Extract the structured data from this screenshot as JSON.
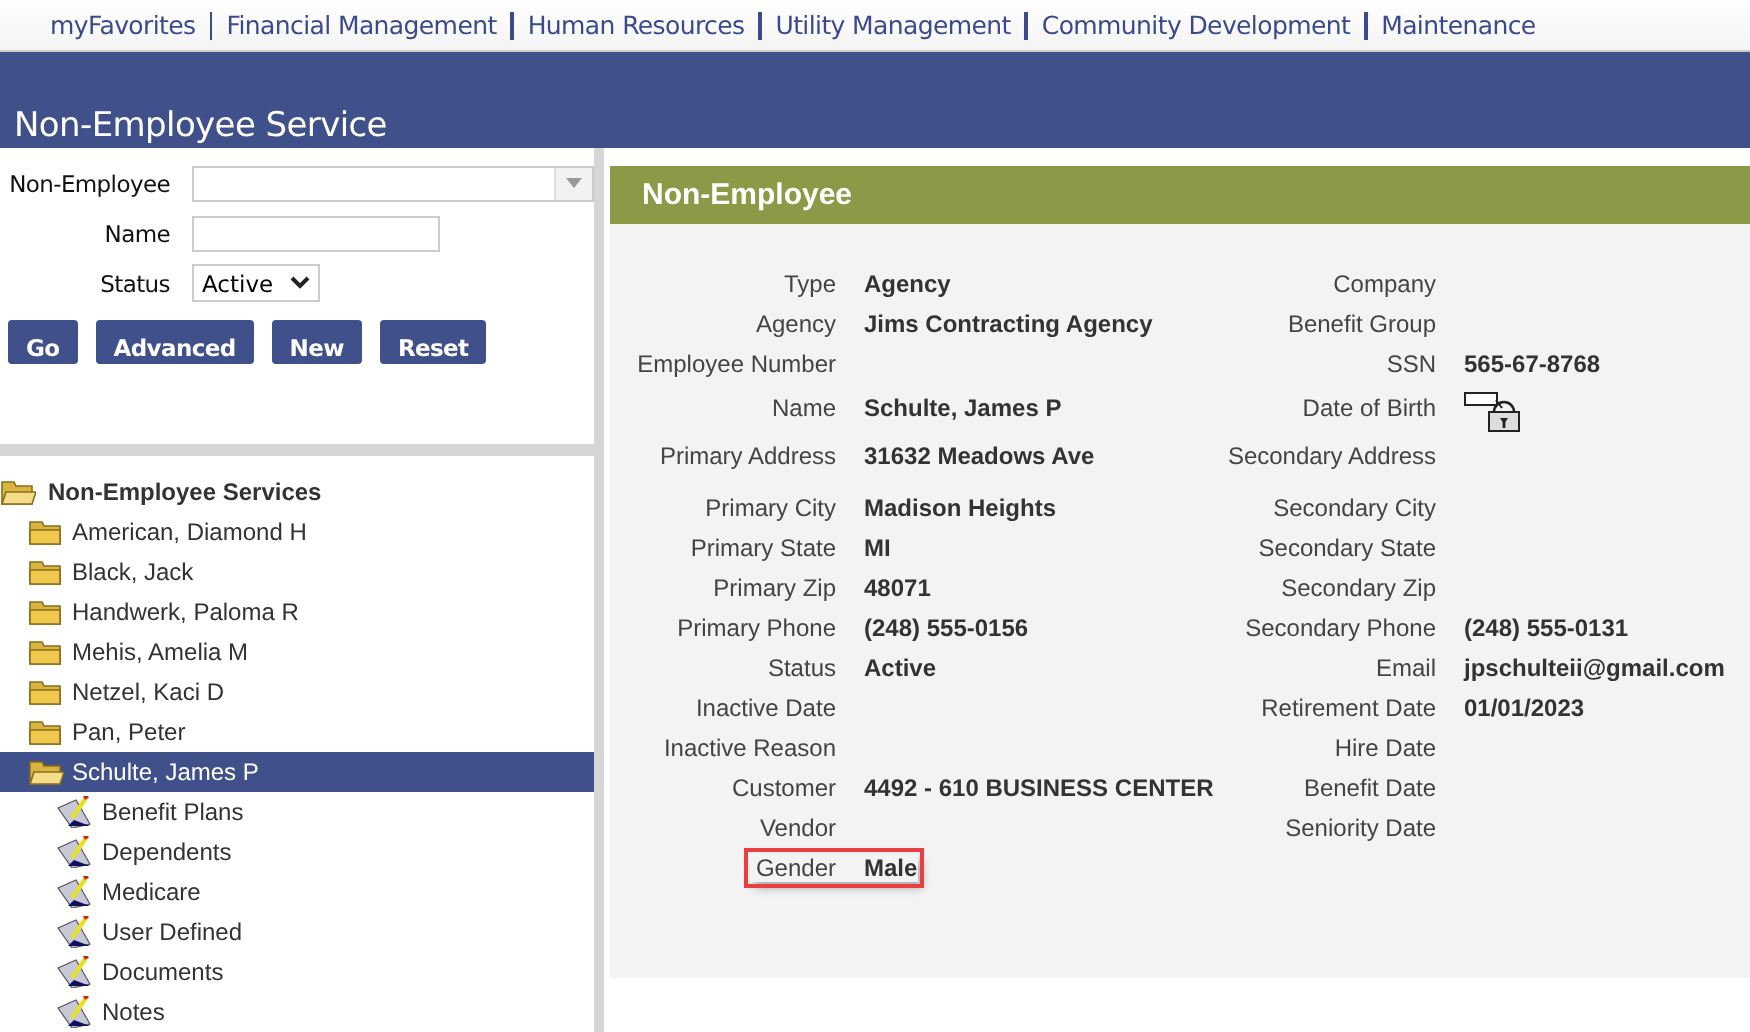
{
  "menu": [
    "myFavorites",
    "Financial Management",
    "Human Resources",
    "Utility Management",
    "Community Development",
    "Maintenance"
  ],
  "page_title": "Non-Employee Service",
  "search": {
    "fields": [
      {
        "kind": "combo",
        "label": "Non-Employee"
      },
      {
        "kind": "text",
        "label": "Name"
      },
      {
        "kind": "select",
        "label": "Status",
        "value": "Active"
      }
    ],
    "buttons": [
      "Go",
      "Advanced",
      "New",
      "Reset"
    ]
  },
  "tree": {
    "label": "Non-Employee Services",
    "expanded": true,
    "children": [
      {
        "label": "American, Diamond H",
        "kind": "folder",
        "expanded": false,
        "selected": false
      },
      {
        "label": "Black, Jack",
        "kind": "folder",
        "expanded": false,
        "selected": false
      },
      {
        "label": "Handwerk, Paloma R",
        "kind": "folder",
        "expanded": false,
        "selected": false
      },
      {
        "label": "Mehis, Amelia M",
        "kind": "folder",
        "expanded": false,
        "selected": false
      },
      {
        "label": "Netzel, Kaci D",
        "kind": "folder",
        "expanded": false,
        "selected": false
      },
      {
        "label": "Pan, Peter",
        "kind": "folder",
        "expanded": false,
        "selected": false
      },
      {
        "label": "Schulte, James P",
        "kind": "folder",
        "expanded": true,
        "selected": true,
        "children": [
          {
            "label": "Benefit Plans",
            "kind": "page",
            "selected": false
          },
          {
            "label": "Dependents",
            "kind": "page",
            "selected": false
          },
          {
            "label": "Medicare",
            "kind": "page",
            "selected": false
          },
          {
            "label": "User Defined",
            "kind": "page",
            "selected": false
          },
          {
            "label": "Documents",
            "kind": "page",
            "selected": false
          },
          {
            "label": "Notes",
            "kind": "page",
            "selected": false
          }
        ]
      }
    ]
  },
  "detail": {
    "title": "Non-Employee",
    "rows": [
      {
        "left": {
          "label": "Type",
          "value": "Agency"
        },
        "right": {
          "label": "Company"
        }
      },
      {
        "left": {
          "label": "Agency",
          "value": "Jims Contracting Agency"
        },
        "right": {
          "label": "Benefit Group"
        }
      },
      {
        "left": {
          "label": "Employee Number"
        },
        "right": {
          "label": "SSN",
          "value": "565-67-8768"
        }
      },
      {
        "left": {
          "label": "Name",
          "value": "Schulte, James P"
        },
        "right": {
          "label": "Date of Birth",
          "masked": true
        },
        "tall": true
      },
      {
        "left": {
          "label": "Primary Address",
          "value": "31632 Meadows Ave"
        },
        "right": {
          "label": "Secondary Address"
        },
        "tall": true
      },
      {
        "left": {
          "label": "Primary City",
          "value": "Madison Heights"
        },
        "right": {
          "label": "Secondary City"
        }
      },
      {
        "left": {
          "label": "Primary State",
          "value": "MI"
        },
        "right": {
          "label": "Secondary State"
        }
      },
      {
        "left": {
          "label": "Primary Zip",
          "value": "48071"
        },
        "right": {
          "label": "Secondary Zip"
        }
      },
      {
        "left": {
          "label": "Primary Phone",
          "value": "(248) 555-0156"
        },
        "right": {
          "label": "Secondary Phone",
          "value": "(248) 555-0131"
        }
      },
      {
        "left": {
          "label": "Status",
          "value": "Active"
        },
        "right": {
          "label": "Email",
          "value": "jpschulteii@gmail.com"
        }
      },
      {
        "left": {
          "label": "Inactive Date"
        },
        "right": {
          "label": "Retirement Date",
          "value": "01/01/2023"
        }
      },
      {
        "left": {
          "label": "Inactive Reason"
        },
        "right": {
          "label": "Hire Date"
        }
      },
      {
        "left": {
          "label": "Customer",
          "value": "4492 - 610 BUSINESS CENTER"
        },
        "right": {
          "label": "Benefit Date"
        }
      },
      {
        "left": {
          "label": "Vendor"
        },
        "right": {
          "label": "Seniority Date"
        }
      },
      {
        "left": {
          "label": "Gender",
          "value": "Male",
          "highlighted": true
        }
      }
    ]
  }
}
